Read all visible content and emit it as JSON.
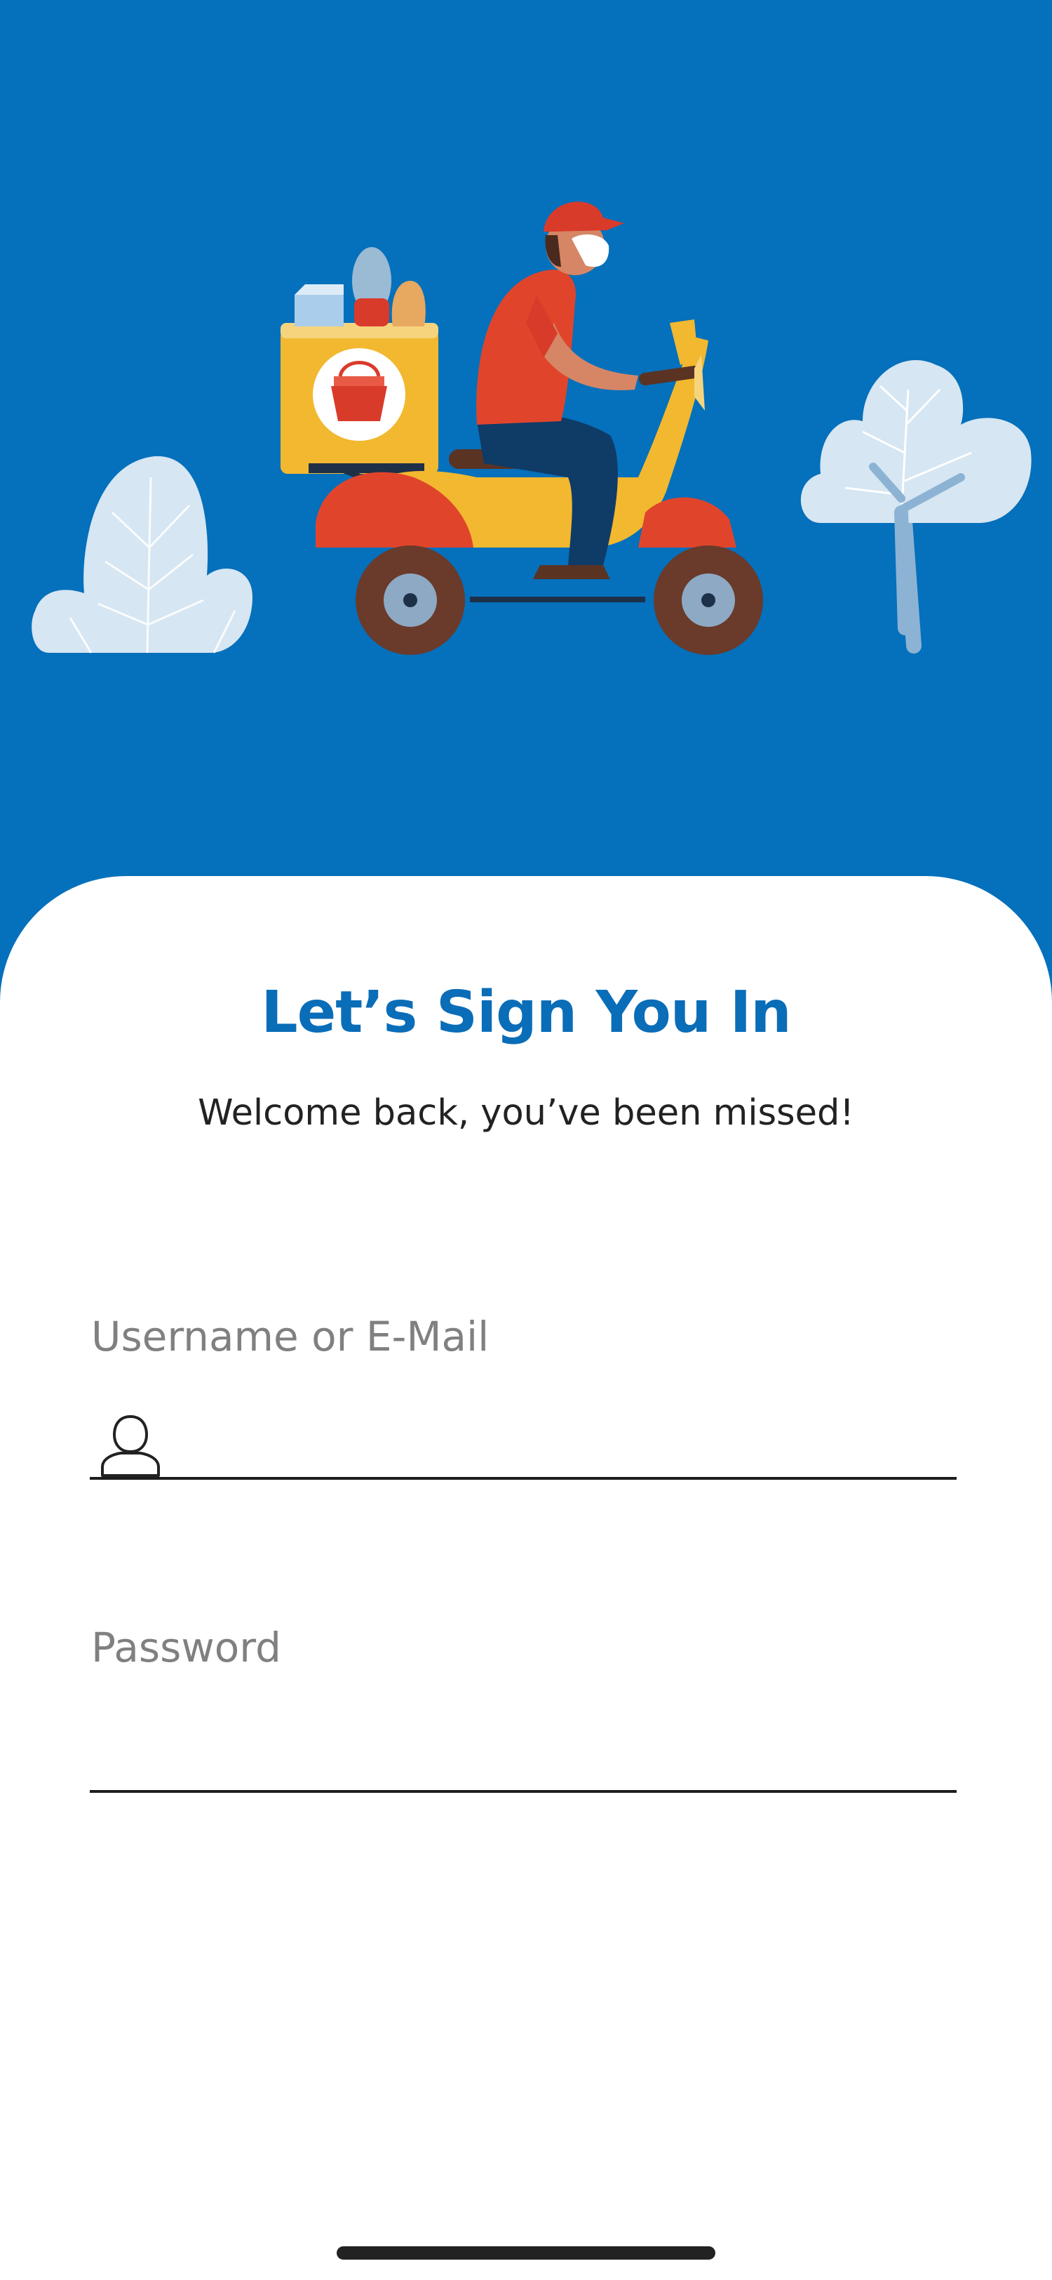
{
  "login": {
    "title": "Let’s Sign You In",
    "subtitle": "Welcome back, you’ve been missed!",
    "username_label": "Username or E-Mail",
    "username_value": "",
    "password_label": "Password",
    "password_value": ""
  },
  "icons": {
    "username_icon": "user-icon",
    "hero_illustration": "delivery-scooter-illustration"
  },
  "colors": {
    "brand_blue": "#0570BB",
    "title_blue": "#0A6DB8",
    "label_gray": "#808080"
  }
}
